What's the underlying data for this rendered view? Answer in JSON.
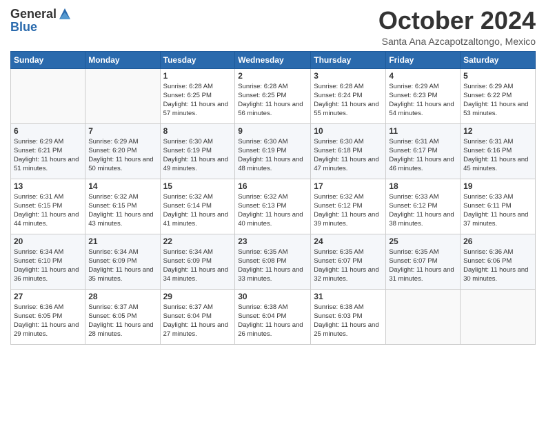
{
  "header": {
    "logo": {
      "text_general": "General",
      "text_blue": "Blue"
    },
    "title": "October 2024",
    "location": "Santa Ana Azcapotzaltongo, Mexico"
  },
  "days_of_week": [
    "Sunday",
    "Monday",
    "Tuesday",
    "Wednesday",
    "Thursday",
    "Friday",
    "Saturday"
  ],
  "weeks": [
    [
      {
        "day": "",
        "sunrise": "",
        "sunset": "",
        "daylight": ""
      },
      {
        "day": "",
        "sunrise": "",
        "sunset": "",
        "daylight": ""
      },
      {
        "day": "1",
        "sunrise": "Sunrise: 6:28 AM",
        "sunset": "Sunset: 6:25 PM",
        "daylight": "Daylight: 11 hours and 57 minutes."
      },
      {
        "day": "2",
        "sunrise": "Sunrise: 6:28 AM",
        "sunset": "Sunset: 6:25 PM",
        "daylight": "Daylight: 11 hours and 56 minutes."
      },
      {
        "day": "3",
        "sunrise": "Sunrise: 6:28 AM",
        "sunset": "Sunset: 6:24 PM",
        "daylight": "Daylight: 11 hours and 55 minutes."
      },
      {
        "day": "4",
        "sunrise": "Sunrise: 6:29 AM",
        "sunset": "Sunset: 6:23 PM",
        "daylight": "Daylight: 11 hours and 54 minutes."
      },
      {
        "day": "5",
        "sunrise": "Sunrise: 6:29 AM",
        "sunset": "Sunset: 6:22 PM",
        "daylight": "Daylight: 11 hours and 53 minutes."
      }
    ],
    [
      {
        "day": "6",
        "sunrise": "Sunrise: 6:29 AM",
        "sunset": "Sunset: 6:21 PM",
        "daylight": "Daylight: 11 hours and 51 minutes."
      },
      {
        "day": "7",
        "sunrise": "Sunrise: 6:29 AM",
        "sunset": "Sunset: 6:20 PM",
        "daylight": "Daylight: 11 hours and 50 minutes."
      },
      {
        "day": "8",
        "sunrise": "Sunrise: 6:30 AM",
        "sunset": "Sunset: 6:19 PM",
        "daylight": "Daylight: 11 hours and 49 minutes."
      },
      {
        "day": "9",
        "sunrise": "Sunrise: 6:30 AM",
        "sunset": "Sunset: 6:19 PM",
        "daylight": "Daylight: 11 hours and 48 minutes."
      },
      {
        "day": "10",
        "sunrise": "Sunrise: 6:30 AM",
        "sunset": "Sunset: 6:18 PM",
        "daylight": "Daylight: 11 hours and 47 minutes."
      },
      {
        "day": "11",
        "sunrise": "Sunrise: 6:31 AM",
        "sunset": "Sunset: 6:17 PM",
        "daylight": "Daylight: 11 hours and 46 minutes."
      },
      {
        "day": "12",
        "sunrise": "Sunrise: 6:31 AM",
        "sunset": "Sunset: 6:16 PM",
        "daylight": "Daylight: 11 hours and 45 minutes."
      }
    ],
    [
      {
        "day": "13",
        "sunrise": "Sunrise: 6:31 AM",
        "sunset": "Sunset: 6:15 PM",
        "daylight": "Daylight: 11 hours and 44 minutes."
      },
      {
        "day": "14",
        "sunrise": "Sunrise: 6:32 AM",
        "sunset": "Sunset: 6:15 PM",
        "daylight": "Daylight: 11 hours and 43 minutes."
      },
      {
        "day": "15",
        "sunrise": "Sunrise: 6:32 AM",
        "sunset": "Sunset: 6:14 PM",
        "daylight": "Daylight: 11 hours and 41 minutes."
      },
      {
        "day": "16",
        "sunrise": "Sunrise: 6:32 AM",
        "sunset": "Sunset: 6:13 PM",
        "daylight": "Daylight: 11 hours and 40 minutes."
      },
      {
        "day": "17",
        "sunrise": "Sunrise: 6:32 AM",
        "sunset": "Sunset: 6:12 PM",
        "daylight": "Daylight: 11 hours and 39 minutes."
      },
      {
        "day": "18",
        "sunrise": "Sunrise: 6:33 AM",
        "sunset": "Sunset: 6:12 PM",
        "daylight": "Daylight: 11 hours and 38 minutes."
      },
      {
        "day": "19",
        "sunrise": "Sunrise: 6:33 AM",
        "sunset": "Sunset: 6:11 PM",
        "daylight": "Daylight: 11 hours and 37 minutes."
      }
    ],
    [
      {
        "day": "20",
        "sunrise": "Sunrise: 6:34 AM",
        "sunset": "Sunset: 6:10 PM",
        "daylight": "Daylight: 11 hours and 36 minutes."
      },
      {
        "day": "21",
        "sunrise": "Sunrise: 6:34 AM",
        "sunset": "Sunset: 6:09 PM",
        "daylight": "Daylight: 11 hours and 35 minutes."
      },
      {
        "day": "22",
        "sunrise": "Sunrise: 6:34 AM",
        "sunset": "Sunset: 6:09 PM",
        "daylight": "Daylight: 11 hours and 34 minutes."
      },
      {
        "day": "23",
        "sunrise": "Sunrise: 6:35 AM",
        "sunset": "Sunset: 6:08 PM",
        "daylight": "Daylight: 11 hours and 33 minutes."
      },
      {
        "day": "24",
        "sunrise": "Sunrise: 6:35 AM",
        "sunset": "Sunset: 6:07 PM",
        "daylight": "Daylight: 11 hours and 32 minutes."
      },
      {
        "day": "25",
        "sunrise": "Sunrise: 6:35 AM",
        "sunset": "Sunset: 6:07 PM",
        "daylight": "Daylight: 11 hours and 31 minutes."
      },
      {
        "day": "26",
        "sunrise": "Sunrise: 6:36 AM",
        "sunset": "Sunset: 6:06 PM",
        "daylight": "Daylight: 11 hours and 30 minutes."
      }
    ],
    [
      {
        "day": "27",
        "sunrise": "Sunrise: 6:36 AM",
        "sunset": "Sunset: 6:05 PM",
        "daylight": "Daylight: 11 hours and 29 minutes."
      },
      {
        "day": "28",
        "sunrise": "Sunrise: 6:37 AM",
        "sunset": "Sunset: 6:05 PM",
        "daylight": "Daylight: 11 hours and 28 minutes."
      },
      {
        "day": "29",
        "sunrise": "Sunrise: 6:37 AM",
        "sunset": "Sunset: 6:04 PM",
        "daylight": "Daylight: 11 hours and 27 minutes."
      },
      {
        "day": "30",
        "sunrise": "Sunrise: 6:38 AM",
        "sunset": "Sunset: 6:04 PM",
        "daylight": "Daylight: 11 hours and 26 minutes."
      },
      {
        "day": "31",
        "sunrise": "Sunrise: 6:38 AM",
        "sunset": "Sunset: 6:03 PM",
        "daylight": "Daylight: 11 hours and 25 minutes."
      },
      {
        "day": "",
        "sunrise": "",
        "sunset": "",
        "daylight": ""
      },
      {
        "day": "",
        "sunrise": "",
        "sunset": "",
        "daylight": ""
      }
    ]
  ]
}
